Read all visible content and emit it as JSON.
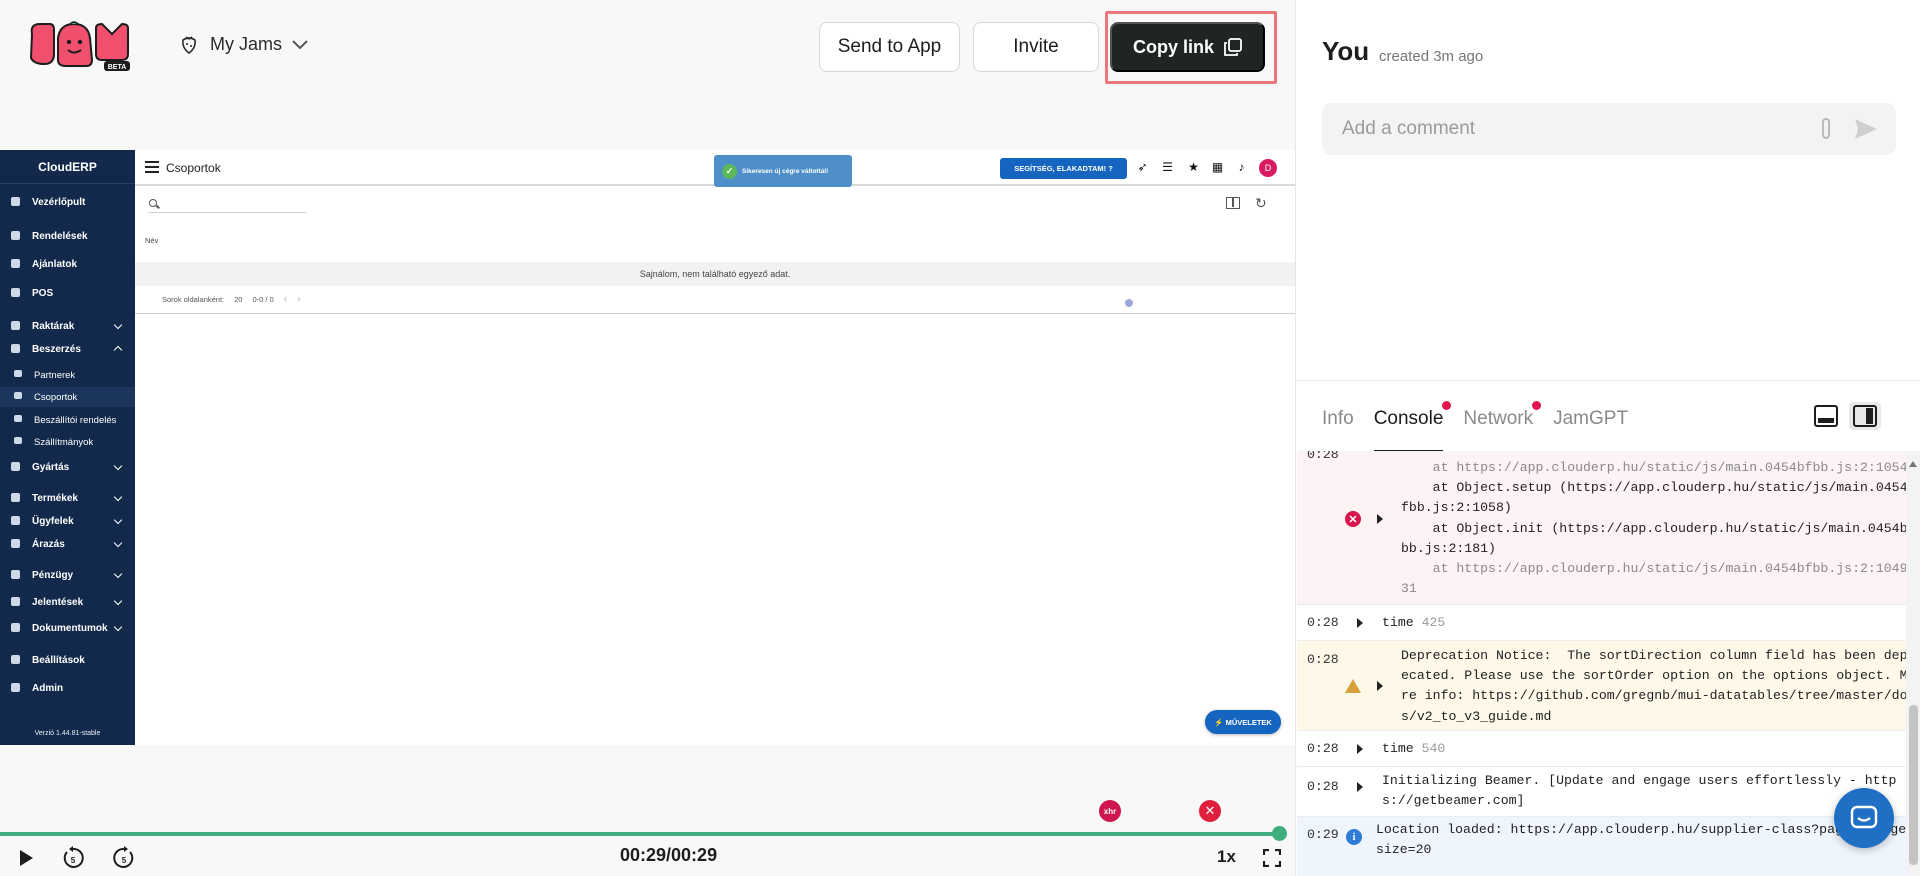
{
  "header": {
    "logo_badge": "BETA",
    "workspace": "My Jams",
    "send_to_app": "Send to App",
    "invite": "Invite",
    "copy_link": "Copy link"
  },
  "erp": {
    "brand": "CloudERP",
    "page_title": "Csoportok",
    "toast": "Sikeresen új cégre váltottál!",
    "help_button": "SEGÍTSÉG, ELAKADTAM! ?",
    "avatar_letter": "D",
    "sidebar": {
      "dashboard": "Vezérlőpult",
      "orders": "Rendelések",
      "offers": "Ajánlatok",
      "pos": "POS",
      "warehouses": "Raktárak",
      "purchasing": "Beszerzés",
      "partners": "Partnerek",
      "groups": "Csoportok",
      "supplier_orders": "Beszállítói rendelés",
      "shipments": "Szállítmányok",
      "manufacturing": "Gyártás",
      "products": "Termékek",
      "customers": "Ügyfelek",
      "pricing": "Árazás",
      "finance": "Pénzügy",
      "reports": "Jelentések",
      "documents": "Dokumentumok",
      "settings": "Beállítások",
      "admin": "Admin",
      "version": "Verzió 1.44.81-stable"
    },
    "column_header": "Név",
    "empty_message": "Sajnálom, nem található egyező adat.",
    "rows_per_page_label": "Sorok oldalanként:",
    "rows_per_page_value": "20",
    "page_range": "0-0 / 0",
    "actions_button": "⚡ MŰVELETEK"
  },
  "player": {
    "time": "00:29/00:29",
    "speed": "1x",
    "marker_xhr": "xhr",
    "progress": 1.0
  },
  "panel": {
    "author": "You",
    "created": "created 3m ago",
    "comment_placeholder": "Add a comment",
    "tabs": [
      "Info",
      "Console",
      "Network",
      "JamGPT"
    ]
  },
  "console": {
    "error_time": "0:28",
    "error_lines": [
      "    at https://app.clouderp.hu/static/js/main.0454bfbb.js:2:1054",
      "    at Object.setup (https://app.clouderp.hu/static/js/main.0454b",
      "fbb.js:2:1058)",
      "    at Object.init (https://app.clouderp.hu/static/js/main.0454bf",
      "bb.js:2:181)",
      "    at https://app.clouderp.hu/static/js/main.0454bfbb.js:2:10491",
      "31"
    ],
    "time1_stamp": "0:28",
    "time1_label": "time",
    "time1_value": "425",
    "warn_time": "0:28",
    "warn_lines": [
      "Deprecation Notice:  The sortDirection column field has been depr",
      "ecated. Please use the sortOrder option on the options object. Mo",
      "re info: https://github.com/gregnb/mui-datatables/tree/master/doc",
      "s/v2_to_v3_guide.md"
    ],
    "time2_stamp": "0:28",
    "time2_label": "time",
    "time2_value": "540",
    "beamer_time": "0:28",
    "beamer_lines": [
      "Initializing Beamer. [Update and engage users effortlessly - http",
      "s://getbeamer.com]"
    ],
    "loc_time": "0:29",
    "loc_lines": [
      "Location loaded: https://app.clouderp.hu/supplier-class?page=1&page",
      "size=20"
    ]
  },
  "colors": {
    "brand_pink": "#f0506e",
    "timeline_green": "#3fae7d",
    "erp_sidebar": "#13294b",
    "erp_blue": "#1565c0",
    "copy_button": "#1f2522"
  }
}
